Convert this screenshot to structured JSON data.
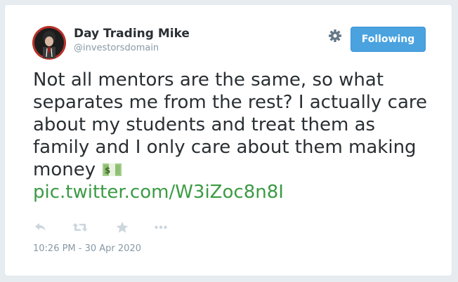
{
  "author": {
    "display_name": "Day Trading Mike",
    "handle": "@investorsdomain",
    "avatar_icon": "profile-photo"
  },
  "header": {
    "settings_icon": "gear-icon",
    "follow_button_label": "Following",
    "follow_button_color": "#4aa3df"
  },
  "tweet": {
    "text": "Not all mentors are the same, so what separates me from the rest? I actually care about my students and treat them as family and I only care about them making money",
    "emoji": "money-bill-emoji",
    "link": "pic.twitter.com/W3iZoc8n8I",
    "link_color": "#3b9b44"
  },
  "actions": [
    {
      "icon": "reply-icon"
    },
    {
      "icon": "retweet-icon"
    },
    {
      "icon": "like-star-icon"
    },
    {
      "icon": "more-icon"
    }
  ],
  "timestamp": "10:26 PM - 30 Apr 2020"
}
